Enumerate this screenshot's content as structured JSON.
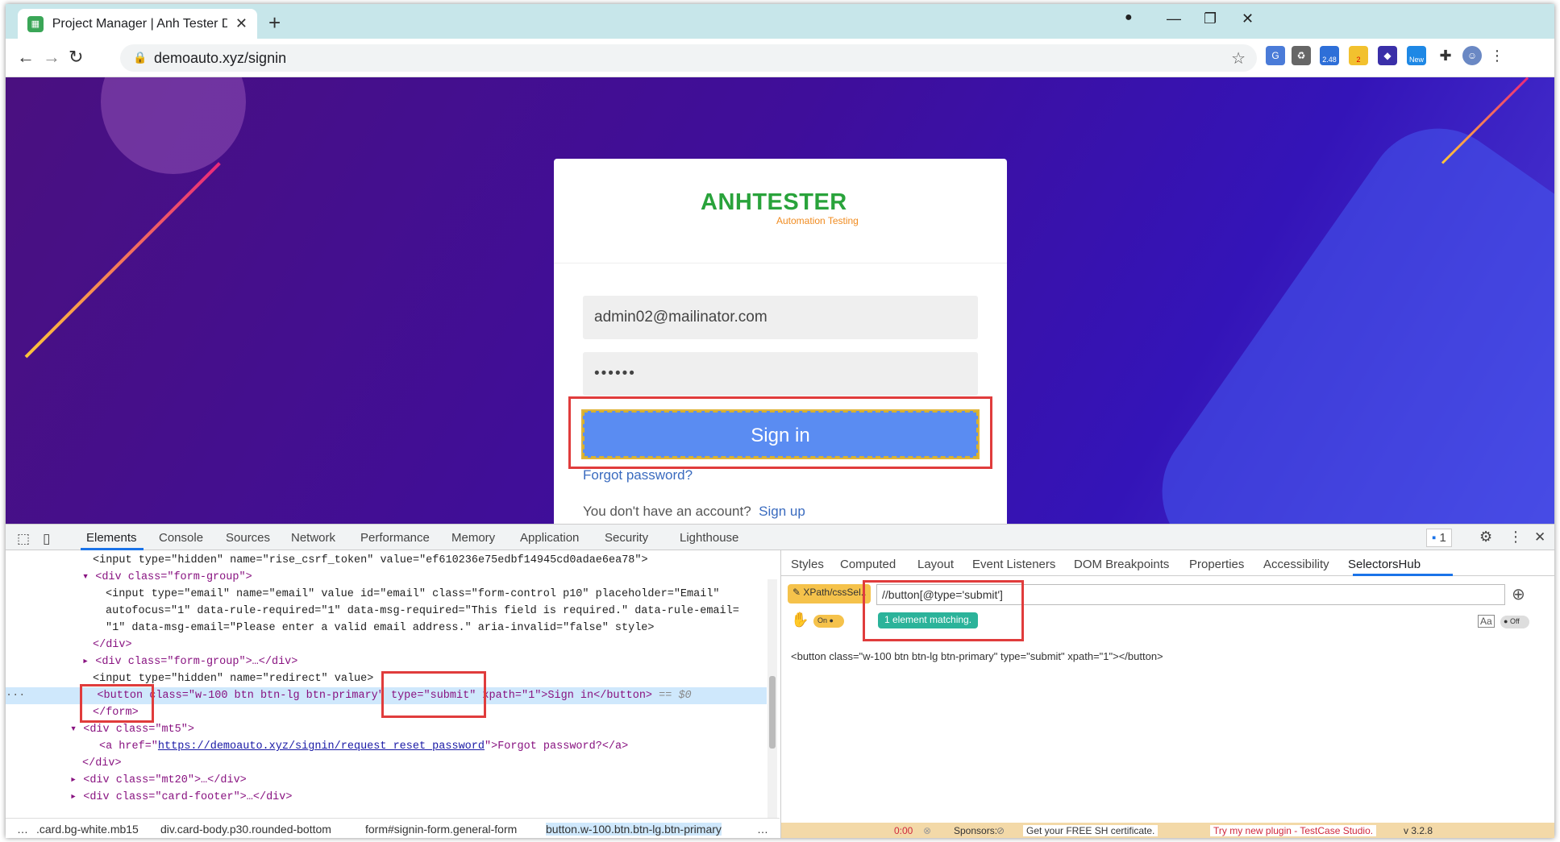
{
  "browser": {
    "tab_title": "Project Manager | Anh Tester Demo",
    "url": "demoauto.xyz/signin"
  },
  "extensions": {
    "badge_248": "2.48",
    "badge_2": "2",
    "badge_new": "New"
  },
  "login": {
    "logo_text": "ANHTESTER",
    "logo_tagline": "Automation Testing",
    "email_value": "admin02@mailinator.com",
    "password_value": "••••••",
    "signin_label": "Sign in",
    "forgot_label": "Forgot password?",
    "no_account": "You don't have an account?",
    "signup_label": "Sign up"
  },
  "devtools": {
    "tabs": [
      "Elements",
      "Console",
      "Sources",
      "Network",
      "Performance",
      "Memory",
      "Application",
      "Security",
      "Lighthouse"
    ],
    "issues_count": "1",
    "elements": {
      "l1": "<input type=\"hidden\" name=\"rise_csrf_token\" value=\"ef610236e75edbf14945cd0adae6ea78\">",
      "l2": "<div class=\"form-group\">",
      "l3": "<input type=\"email\" name=\"email\" value id=\"email\" class=\"form-control p10\" placeholder=\"Email\"",
      "l4": "autofocus=\"1\" data-rule-required=\"1\" data-msg-required=\"This field is required.\" data-rule-email=",
      "l5": "\"1\" data-msg-email=\"Please enter a valid email address.\" aria-invalid=\"false\" style>",
      "l6": "</div>",
      "l7": "<div class=\"form-group\">…</div>",
      "l8": "<input type=\"hidden\" name=\"redirect\" value>",
      "l9a": "<button class=\"w-100 btn btn-lg btn-primary\" type=\"submit\" xpath=\"1\">Sign in</button>",
      "l9b": " == $0",
      "l10": "</form>",
      "l11": "<div class=\"mt5\">",
      "l12a": "<a href=\"",
      "l12link": "https://demoauto.xyz/signin/request_reset_password",
      "l12b": "\">Forgot password?</a>",
      "l13": "</div>",
      "l14": "<div class=\"mt20\">…</div>",
      "l15": "<div class=\"card-footer\">…</div>"
    },
    "breadcrumbs": [
      "…",
      ".card.bg-white.mb15",
      "div.card-body.p30.rounded-bottom",
      "form#signin-form.general-form",
      "button.w-100.btn.btn-lg.btn-primary",
      "…"
    ],
    "side_tabs": [
      "Styles",
      "Computed",
      "Layout",
      "Event Listeners",
      "DOM Breakpoints",
      "Properties",
      "Accessibility",
      "SelectorsHub"
    ],
    "selectorshub": {
      "badge": "XPath/cssSel..",
      "xpath_value": "//button[@type='submit']",
      "match_label": "1 element matching.",
      "on_label": "On",
      "off_label": "Off",
      "result": "<button class=\"w-100 btn btn-lg btn-primary\" type=\"submit\" xpath=\"1\"></button>"
    },
    "footer": {
      "timer": "0:00",
      "sponsors": "Sponsors:",
      "cert": "Get your FREE SH certificate.",
      "plugin": "Try my new plugin - TestCase Studio.",
      "version": "v 3.2.8"
    }
  }
}
